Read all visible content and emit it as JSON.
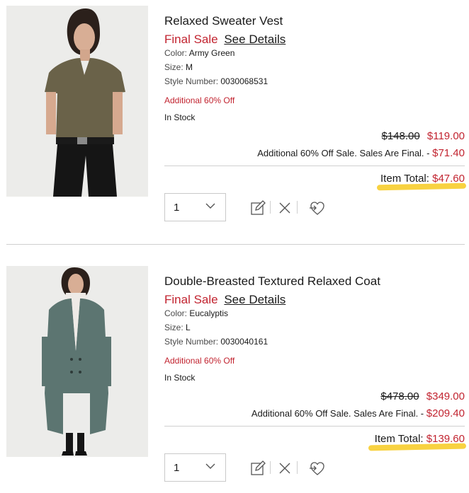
{
  "items": [
    {
      "name": "Relaxed Sweater Vest",
      "final_sale": "Final Sale",
      "see_details": "See Details",
      "color_label": "Color:",
      "color_value": "Army Green",
      "size_label": "Size:",
      "size_value": "M",
      "style_label": "Style Number:",
      "style_value": "0030068531",
      "promo": "Additional 60% Off",
      "stock": "In Stock",
      "original_price": "$148.00",
      "sale_price": "$119.00",
      "extra_label": "Additional 60% Off Sale. Sales Are Final. -",
      "extra_amount": "$71.40",
      "total_label": "Item Total:",
      "total_value": "$47.60",
      "quantity": "1",
      "image_alt": "Woman wearing olive green sweater vest and black jeans"
    },
    {
      "name": "Double-Breasted Textured Relaxed Coat",
      "final_sale": "Final Sale",
      "see_details": "See Details",
      "color_label": "Color:",
      "color_value": "Eucalyptis",
      "size_label": "Size:",
      "size_value": "L",
      "style_label": "Style Number:",
      "style_value": "0030040161",
      "promo": "Additional 60% Off",
      "stock": "In Stock",
      "original_price": "$478.00",
      "sale_price": "$349.00",
      "extra_label": "Additional 60% Off Sale. Sales Are Final. -",
      "extra_amount": "$209.40",
      "total_label": "Item Total:",
      "total_value": "$139.60",
      "quantity": "1",
      "image_alt": "Woman wearing green-gray textured coat over white turtleneck"
    }
  ],
  "colors": {
    "sale_red": "#c22430",
    "highlight_yellow": "#f7cd2c",
    "divider": "#cfcfcf"
  },
  "icons": {
    "edit": "edit-icon",
    "remove": "close-icon",
    "save_for_later": "move-to-wishlist-icon",
    "quantity_dropdown": "chevron-down-icon"
  }
}
